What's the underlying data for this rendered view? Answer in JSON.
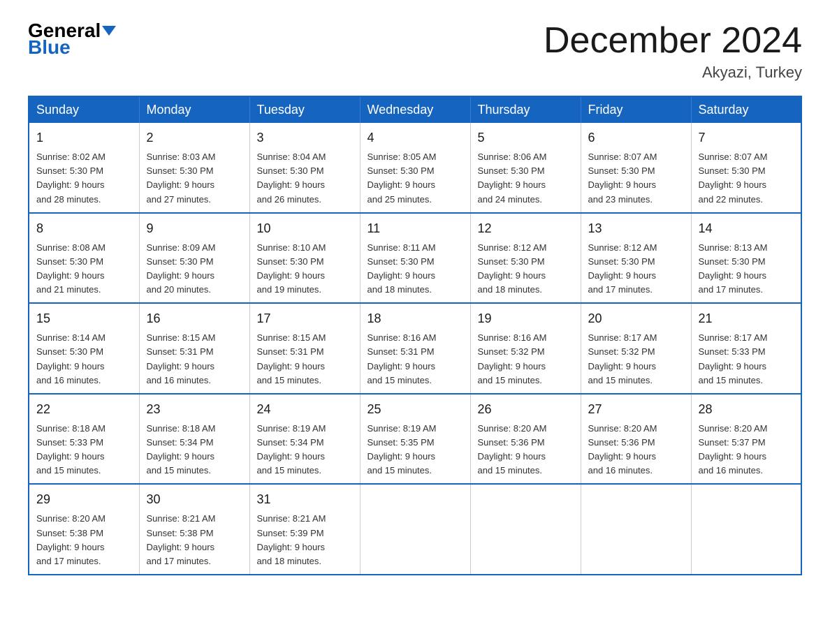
{
  "header": {
    "logo_line1": "General",
    "logo_line2": "Blue",
    "month_title": "December 2024",
    "location": "Akyazi, Turkey"
  },
  "weekdays": [
    "Sunday",
    "Monday",
    "Tuesday",
    "Wednesday",
    "Thursday",
    "Friday",
    "Saturday"
  ],
  "weeks": [
    [
      {
        "day": "1",
        "info": "Sunrise: 8:02 AM\nSunset: 5:30 PM\nDaylight: 9 hours\nand 28 minutes."
      },
      {
        "day": "2",
        "info": "Sunrise: 8:03 AM\nSunset: 5:30 PM\nDaylight: 9 hours\nand 27 minutes."
      },
      {
        "day": "3",
        "info": "Sunrise: 8:04 AM\nSunset: 5:30 PM\nDaylight: 9 hours\nand 26 minutes."
      },
      {
        "day": "4",
        "info": "Sunrise: 8:05 AM\nSunset: 5:30 PM\nDaylight: 9 hours\nand 25 minutes."
      },
      {
        "day": "5",
        "info": "Sunrise: 8:06 AM\nSunset: 5:30 PM\nDaylight: 9 hours\nand 24 minutes."
      },
      {
        "day": "6",
        "info": "Sunrise: 8:07 AM\nSunset: 5:30 PM\nDaylight: 9 hours\nand 23 minutes."
      },
      {
        "day": "7",
        "info": "Sunrise: 8:07 AM\nSunset: 5:30 PM\nDaylight: 9 hours\nand 22 minutes."
      }
    ],
    [
      {
        "day": "8",
        "info": "Sunrise: 8:08 AM\nSunset: 5:30 PM\nDaylight: 9 hours\nand 21 minutes."
      },
      {
        "day": "9",
        "info": "Sunrise: 8:09 AM\nSunset: 5:30 PM\nDaylight: 9 hours\nand 20 minutes."
      },
      {
        "day": "10",
        "info": "Sunrise: 8:10 AM\nSunset: 5:30 PM\nDaylight: 9 hours\nand 19 minutes."
      },
      {
        "day": "11",
        "info": "Sunrise: 8:11 AM\nSunset: 5:30 PM\nDaylight: 9 hours\nand 18 minutes."
      },
      {
        "day": "12",
        "info": "Sunrise: 8:12 AM\nSunset: 5:30 PM\nDaylight: 9 hours\nand 18 minutes."
      },
      {
        "day": "13",
        "info": "Sunrise: 8:12 AM\nSunset: 5:30 PM\nDaylight: 9 hours\nand 17 minutes."
      },
      {
        "day": "14",
        "info": "Sunrise: 8:13 AM\nSunset: 5:30 PM\nDaylight: 9 hours\nand 17 minutes."
      }
    ],
    [
      {
        "day": "15",
        "info": "Sunrise: 8:14 AM\nSunset: 5:30 PM\nDaylight: 9 hours\nand 16 minutes."
      },
      {
        "day": "16",
        "info": "Sunrise: 8:15 AM\nSunset: 5:31 PM\nDaylight: 9 hours\nand 16 minutes."
      },
      {
        "day": "17",
        "info": "Sunrise: 8:15 AM\nSunset: 5:31 PM\nDaylight: 9 hours\nand 15 minutes."
      },
      {
        "day": "18",
        "info": "Sunrise: 8:16 AM\nSunset: 5:31 PM\nDaylight: 9 hours\nand 15 minutes."
      },
      {
        "day": "19",
        "info": "Sunrise: 8:16 AM\nSunset: 5:32 PM\nDaylight: 9 hours\nand 15 minutes."
      },
      {
        "day": "20",
        "info": "Sunrise: 8:17 AM\nSunset: 5:32 PM\nDaylight: 9 hours\nand 15 minutes."
      },
      {
        "day": "21",
        "info": "Sunrise: 8:17 AM\nSunset: 5:33 PM\nDaylight: 9 hours\nand 15 minutes."
      }
    ],
    [
      {
        "day": "22",
        "info": "Sunrise: 8:18 AM\nSunset: 5:33 PM\nDaylight: 9 hours\nand 15 minutes."
      },
      {
        "day": "23",
        "info": "Sunrise: 8:18 AM\nSunset: 5:34 PM\nDaylight: 9 hours\nand 15 minutes."
      },
      {
        "day": "24",
        "info": "Sunrise: 8:19 AM\nSunset: 5:34 PM\nDaylight: 9 hours\nand 15 minutes."
      },
      {
        "day": "25",
        "info": "Sunrise: 8:19 AM\nSunset: 5:35 PM\nDaylight: 9 hours\nand 15 minutes."
      },
      {
        "day": "26",
        "info": "Sunrise: 8:20 AM\nSunset: 5:36 PM\nDaylight: 9 hours\nand 15 minutes."
      },
      {
        "day": "27",
        "info": "Sunrise: 8:20 AM\nSunset: 5:36 PM\nDaylight: 9 hours\nand 16 minutes."
      },
      {
        "day": "28",
        "info": "Sunrise: 8:20 AM\nSunset: 5:37 PM\nDaylight: 9 hours\nand 16 minutes."
      }
    ],
    [
      {
        "day": "29",
        "info": "Sunrise: 8:20 AM\nSunset: 5:38 PM\nDaylight: 9 hours\nand 17 minutes."
      },
      {
        "day": "30",
        "info": "Sunrise: 8:21 AM\nSunset: 5:38 PM\nDaylight: 9 hours\nand 17 minutes."
      },
      {
        "day": "31",
        "info": "Sunrise: 8:21 AM\nSunset: 5:39 PM\nDaylight: 9 hours\nand 18 minutes."
      },
      {
        "day": "",
        "info": ""
      },
      {
        "day": "",
        "info": ""
      },
      {
        "day": "",
        "info": ""
      },
      {
        "day": "",
        "info": ""
      }
    ]
  ]
}
